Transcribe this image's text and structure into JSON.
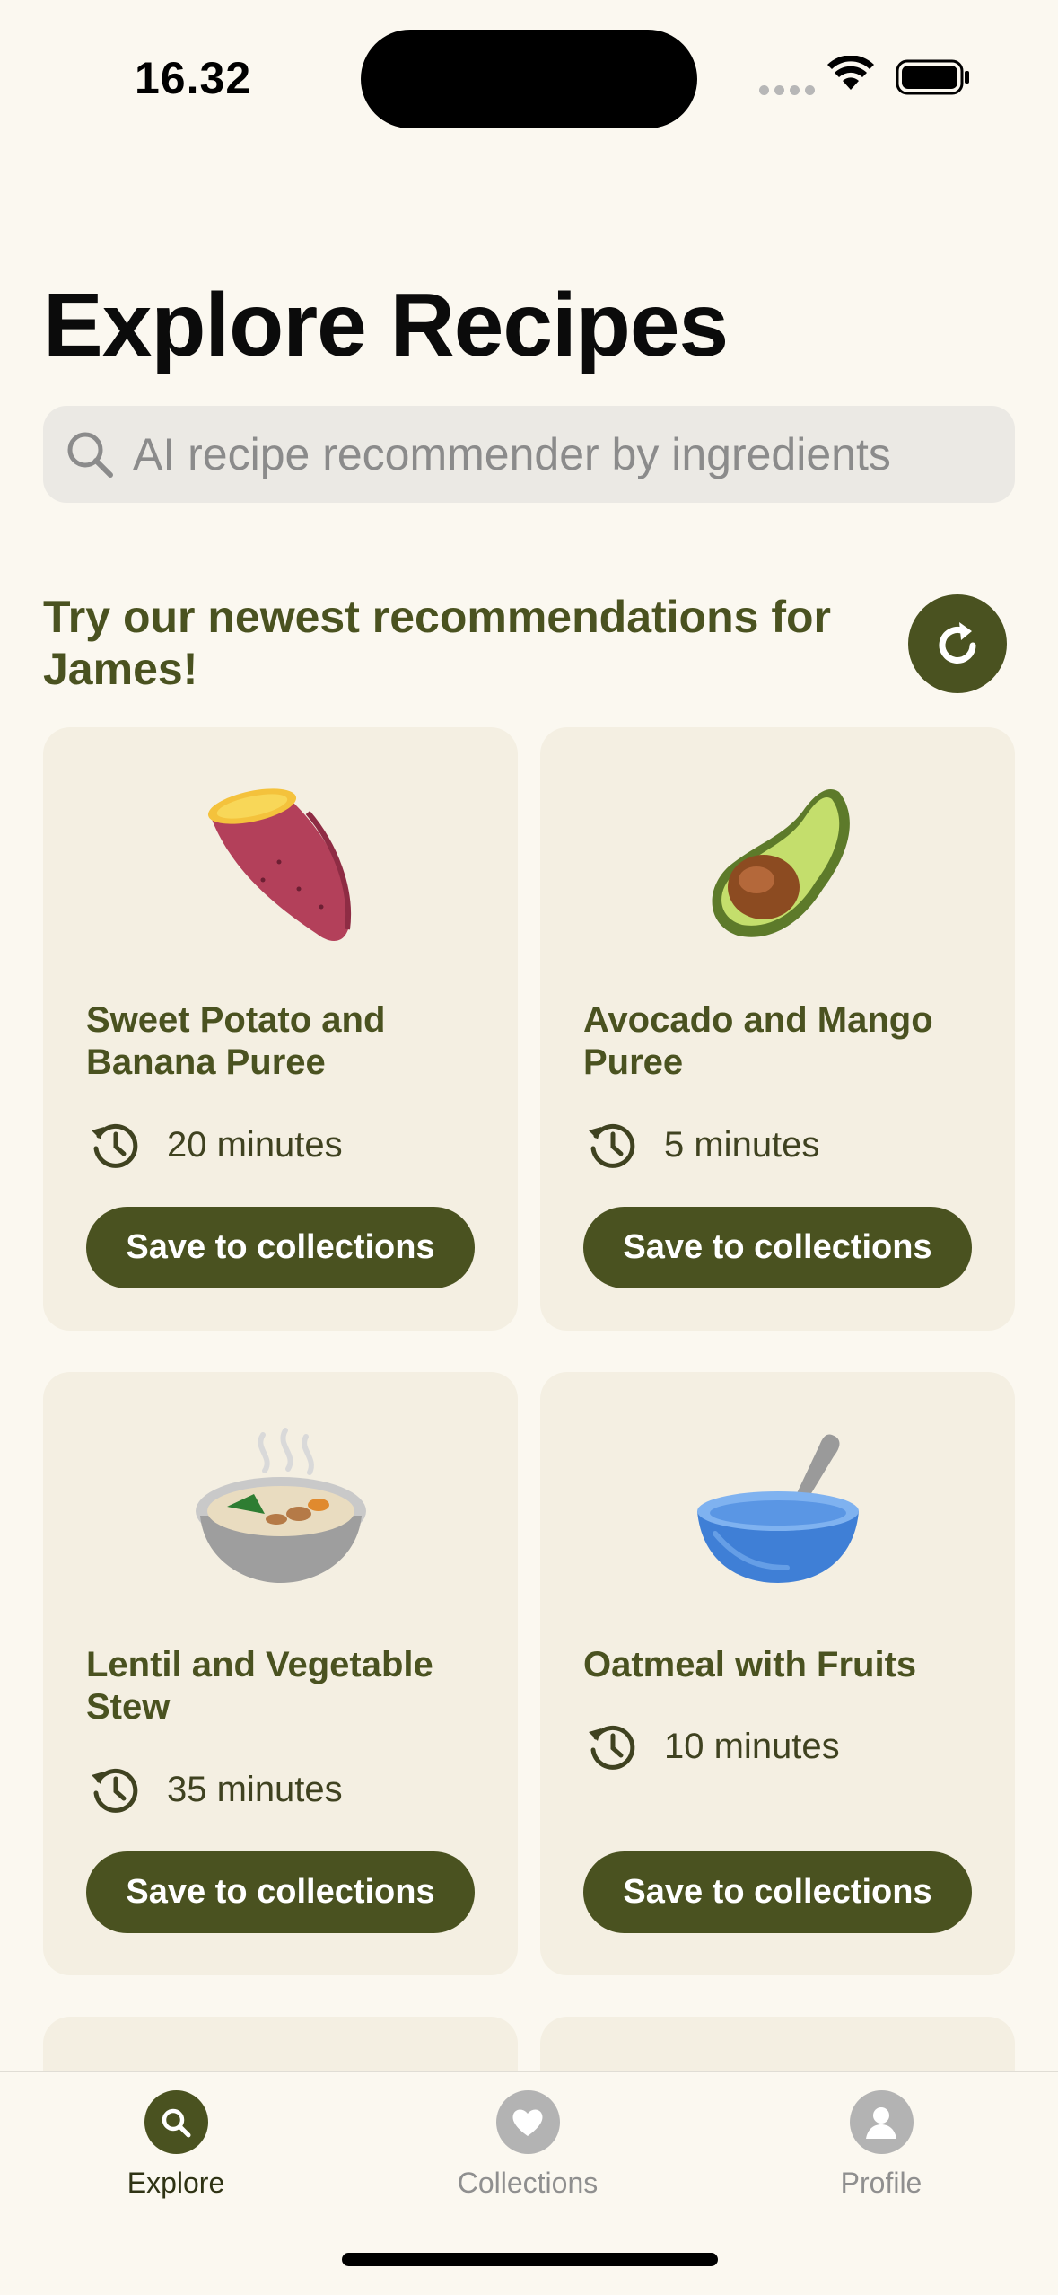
{
  "status_bar": {
    "time": "16.32"
  },
  "page_title": "Explore Recipes",
  "search": {
    "placeholder": "AI recipe recommender by ingredients"
  },
  "recommendations": {
    "heading": "Try our newest recommendations for James!",
    "refresh_icon": "refresh-icon"
  },
  "recipes": [
    {
      "name": "Sweet Potato and Banana Puree",
      "time": "20 minutes",
      "emoji": "sweet-potato",
      "save_label": "Save to collections"
    },
    {
      "name": "Avocado and Mango Puree",
      "time": "5 minutes",
      "emoji": "avocado",
      "save_label": "Save to collections"
    },
    {
      "name": "Lentil and Vegetable Stew",
      "time": "35 minutes",
      "emoji": "stew-bowl",
      "save_label": "Save to collections"
    },
    {
      "name": "Oatmeal with Fruits",
      "time": "10 minutes",
      "emoji": "bowl-with-spoon",
      "save_label": "Save to collections"
    }
  ],
  "tabbar": {
    "explore": "Explore",
    "collections": "Collections",
    "profile": "Profile"
  },
  "colors": {
    "accent": "#4a5220",
    "background": "#fbf8f0",
    "card": "#f4efe2",
    "inactive": "#b3b3b3"
  }
}
